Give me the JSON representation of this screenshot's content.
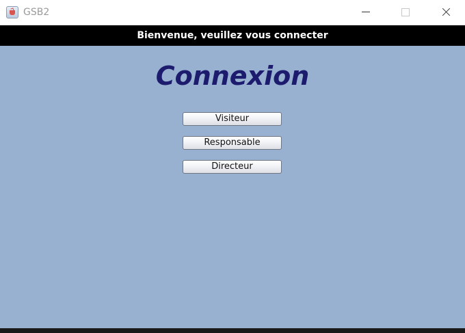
{
  "window": {
    "title": "GSB2",
    "icon": "java-cup-icon",
    "background_color": "#98b1d0"
  },
  "banner": {
    "text": "Bienvenue, veuillez vous connecter"
  },
  "main": {
    "heading": "Connexion",
    "heading_color": "#1c1b6e",
    "buttons": [
      {
        "label": "Visiteur"
      },
      {
        "label": "Responsable"
      },
      {
        "label": "Directeur"
      }
    ]
  }
}
